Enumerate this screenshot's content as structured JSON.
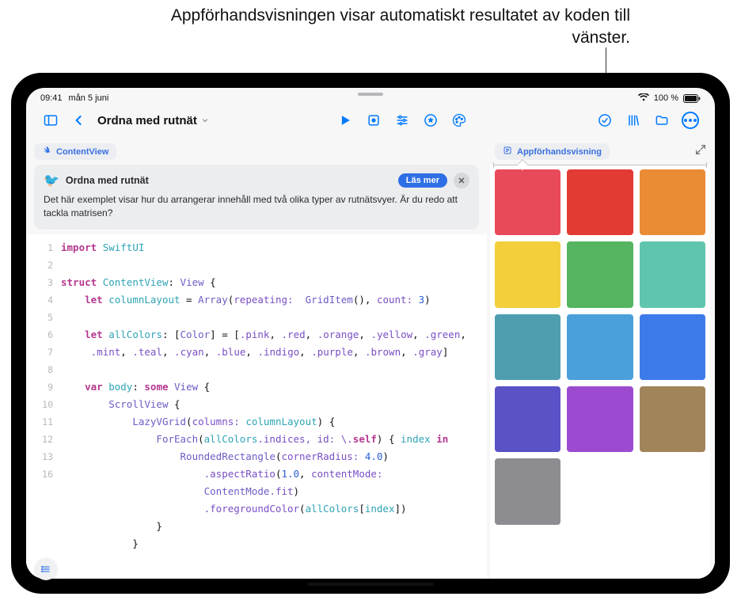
{
  "callout": "Appförhandsvisningen visar automatiskt resultatet av koden till vänster.",
  "status": {
    "time": "09:41",
    "date": "mån 5 juni",
    "battery_text": "100 %"
  },
  "toolbar": {
    "project_title": "Ordna med rutnät"
  },
  "pane": {
    "file_chip": "ContentView",
    "preview_chip": "Appförhandsvisning"
  },
  "banner": {
    "title": "Ordna med rutnät",
    "read_more": "Läs mer",
    "body": "Det här exemplet visar hur du arrangerar innehåll med två olika typer av rutnätsvyer. Är du redo att tackla matrisen?"
  },
  "code": {
    "line_numbers": [
      "1",
      "2",
      "3",
      "4",
      "5",
      "6",
      "",
      "7",
      "8",
      "9",
      "10",
      "11",
      "12",
      "13",
      "",
      "",
      "16"
    ],
    "l1_import": "import",
    "l1_mod": "SwiftUI",
    "l3_struct": "struct",
    "l3_name": "ContentView",
    "l3_view": "View",
    "l4_let": "let",
    "l4_name": "columnLayout",
    "l4_array": "Array",
    "l4_repeating": "repeating:",
    "l4_griditem": "GridItem",
    "l4_count": "count:",
    "l4_num": "3",
    "l6_let": "let",
    "l6_name": "allColors",
    "l6_type": "Color",
    "l6_vals": [
      ".pink",
      ".red",
      ".orange",
      ".yellow",
      ".green"
    ],
    "l6b_vals": [
      ".mint",
      ".teal",
      ".cyan",
      ".blue",
      ".indigo",
      ".purple",
      ".brown",
      ".gray"
    ],
    "l8_var": "var",
    "l8_body": "body",
    "l8_some": "some",
    "l8_view": "View",
    "l9": "ScrollView",
    "l10": "LazyVGrid",
    "l10_cols": "columns:",
    "l10_ref": "columnLayout",
    "l11": "ForEach",
    "l11_all": "allColors",
    "l11_idx": ".indices, id: \\.",
    "l11_self": "self",
    "l11_index": "index",
    "l11_in": "in",
    "l12": "RoundedRectangle",
    "l12_cr": "cornerRadius:",
    "l12_num": "4.0",
    "l13": ".aspectRatio",
    "l13_num": "1.0",
    "l13_cm": "contentMode:",
    "l13b": "ContentMode",
    "l13b_fit": ".fit",
    "l14": ".foregroundColor",
    "l14_all": "allColors",
    "l14_idx": "index"
  },
  "preview": {
    "colors": [
      "#e94a59",
      "#e23a35",
      "#e98c34",
      "#f2cf3b",
      "#55b561",
      "#5fc6ad",
      "#4f9eb0",
      "#4aa0db",
      "#3e7bea",
      "#5a52c6",
      "#9c4bd1",
      "#a2845a",
      "#8d8d91"
    ]
  }
}
